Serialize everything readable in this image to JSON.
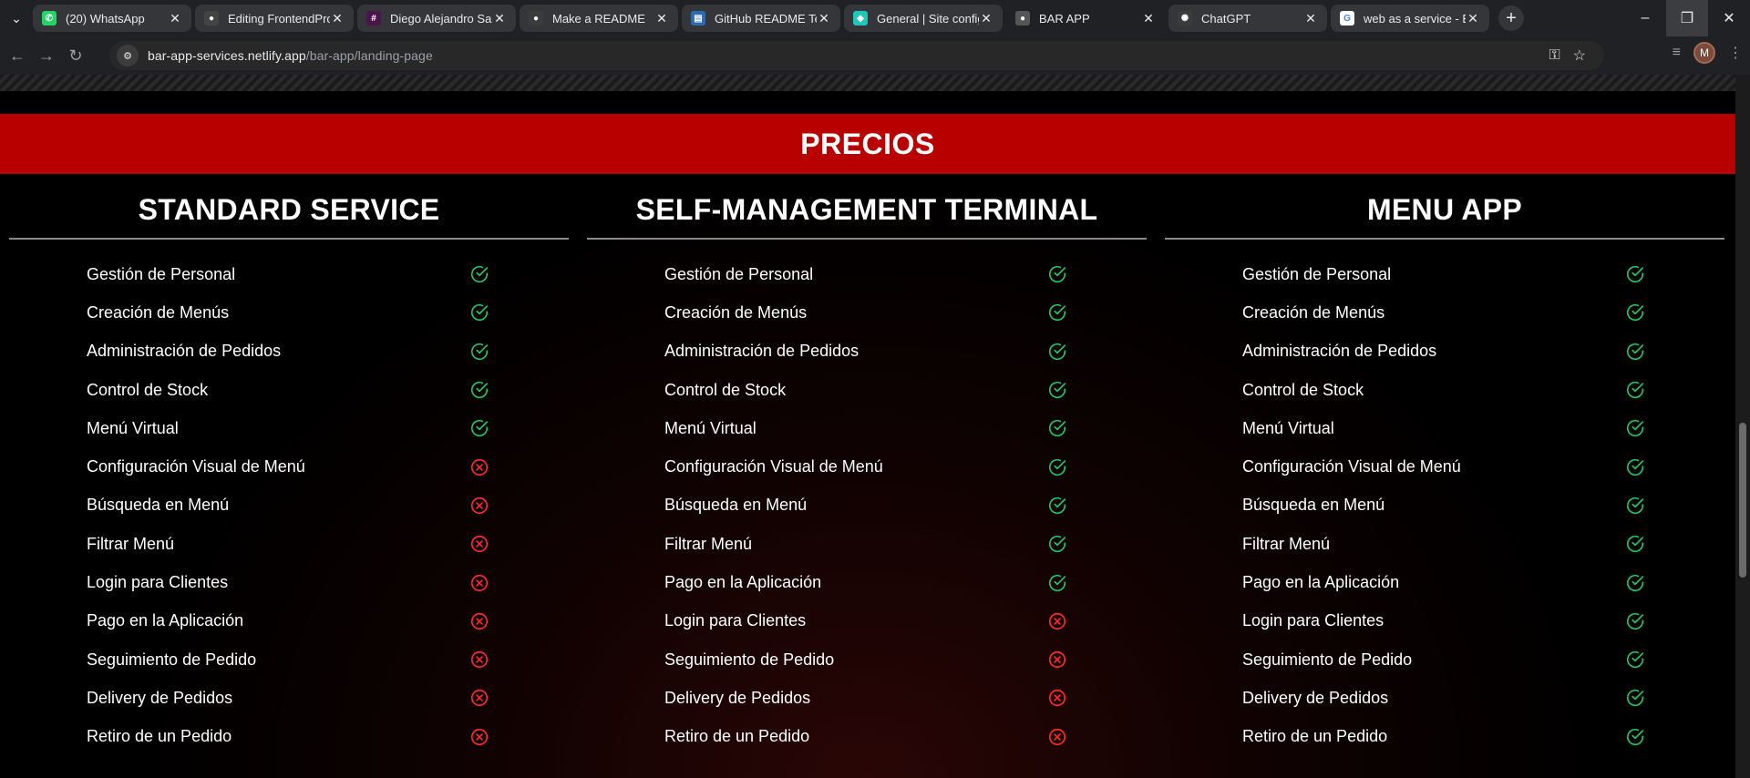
{
  "browser": {
    "tabs": [
      {
        "title": "(20) WhatsApp",
        "icon": "whatsapp-icon",
        "active": false
      },
      {
        "title": "Editing FrontendProye",
        "icon": "github-icon",
        "active": false
      },
      {
        "title": "Diego Alejandro Salel",
        "icon": "slack-icon",
        "active": false
      },
      {
        "title": "Make a README",
        "icon": "globe-icon",
        "active": false
      },
      {
        "title": "GitHub README Temp",
        "icon": "github-readme-icon",
        "active": false
      },
      {
        "title": "General | Site configu",
        "icon": "netlify-icon",
        "active": false
      },
      {
        "title": "BAR APP",
        "icon": "bar-app-icon",
        "active": true
      },
      {
        "title": "ChatGPT",
        "icon": "chatgpt-icon",
        "active": false
      },
      {
        "title": "web as a service - Bus",
        "icon": "google-icon",
        "active": false
      }
    ],
    "address": {
      "domain": "bar-app-services.netlify.app",
      "path": "/bar-app/landing-page"
    },
    "profile_initial": "M"
  },
  "page": {
    "banner_title": "PRECIOS",
    "colors": {
      "banner": "#b90000",
      "check": "#22c55e",
      "cross": "#ff2a2a"
    },
    "plans": [
      {
        "name": "STANDARD SERVICE",
        "features": [
          {
            "label": "Gestión de Personal",
            "included": true
          },
          {
            "label": "Creación de Menús",
            "included": true
          },
          {
            "label": "Administración de Pedidos",
            "included": true
          },
          {
            "label": "Control de Stock",
            "included": true
          },
          {
            "label": "Menú Virtual",
            "included": true
          },
          {
            "label": "Configuración Visual de Menú",
            "included": false
          },
          {
            "label": "Búsqueda en Menú",
            "included": false
          },
          {
            "label": "Filtrar Menú",
            "included": false
          },
          {
            "label": "Login para Clientes",
            "included": false
          },
          {
            "label": "Pago en la Aplicación",
            "included": false
          },
          {
            "label": "Seguimiento de Pedido",
            "included": false
          },
          {
            "label": "Delivery de Pedidos",
            "included": false
          },
          {
            "label": "Retiro de un Pedido",
            "included": false
          }
        ]
      },
      {
        "name": "SELF-MANAGEMENT TERMINAL",
        "features": [
          {
            "label": "Gestión de Personal",
            "included": true
          },
          {
            "label": "Creación de Menús",
            "included": true
          },
          {
            "label": "Administración de Pedidos",
            "included": true
          },
          {
            "label": "Control de Stock",
            "included": true
          },
          {
            "label": "Menú Virtual",
            "included": true
          },
          {
            "label": "Configuración Visual de Menú",
            "included": true
          },
          {
            "label": "Búsqueda en Menú",
            "included": true
          },
          {
            "label": "Filtrar Menú",
            "included": true
          },
          {
            "label": "Pago en la Aplicación",
            "included": true
          },
          {
            "label": "Login para Clientes",
            "included": false
          },
          {
            "label": "Seguimiento de Pedido",
            "included": false
          },
          {
            "label": "Delivery de Pedidos",
            "included": false
          },
          {
            "label": "Retiro de un Pedido",
            "included": false
          }
        ]
      },
      {
        "name": "MENU APP",
        "features": [
          {
            "label": "Gestión de Personal",
            "included": true
          },
          {
            "label": "Creación de Menús",
            "included": true
          },
          {
            "label": "Administración de Pedidos",
            "included": true
          },
          {
            "label": "Control de Stock",
            "included": true
          },
          {
            "label": "Menú Virtual",
            "included": true
          },
          {
            "label": "Configuración Visual de Menú",
            "included": true
          },
          {
            "label": "Búsqueda en Menú",
            "included": true
          },
          {
            "label": "Filtrar Menú",
            "included": true
          },
          {
            "label": "Pago en la Aplicación",
            "included": true
          },
          {
            "label": "Login para Clientes",
            "included": true
          },
          {
            "label": "Seguimiento de Pedido",
            "included": true
          },
          {
            "label": "Delivery de Pedidos",
            "included": true
          },
          {
            "label": "Retiro de un Pedido",
            "included": true
          }
        ]
      }
    ]
  }
}
